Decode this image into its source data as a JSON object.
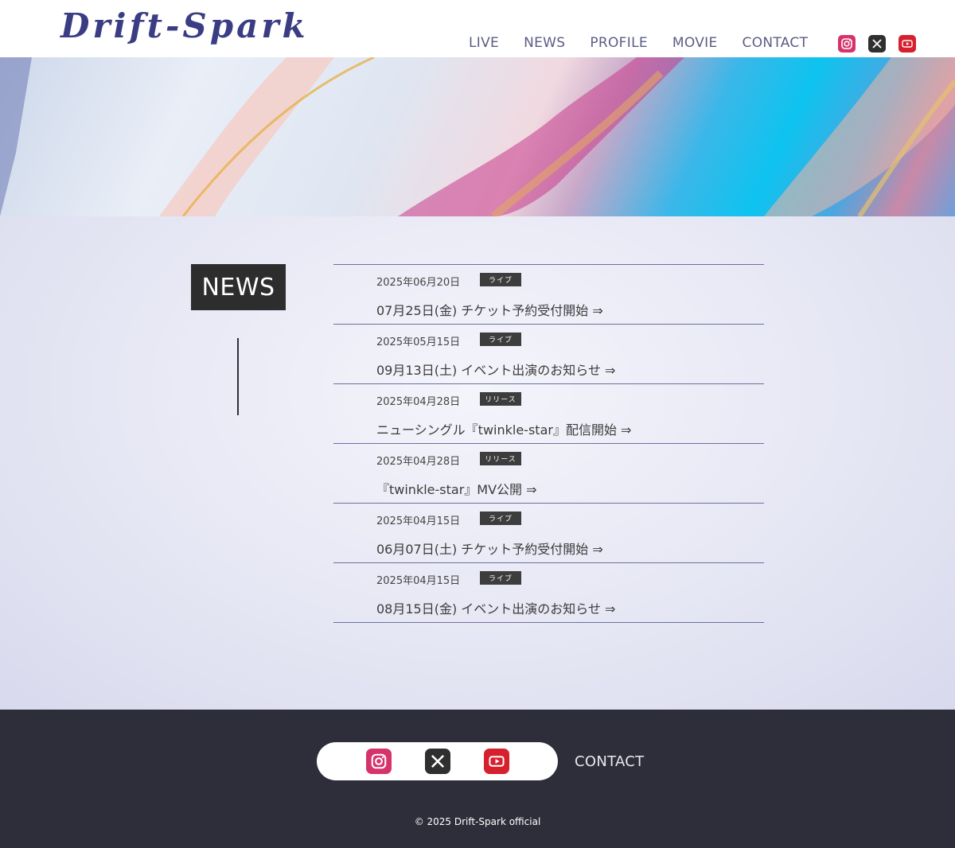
{
  "brand": {
    "logo_text": "Drift-Spark"
  },
  "nav": {
    "items": [
      {
        "label": "LIVE"
      },
      {
        "label": "NEWS"
      },
      {
        "label": "PROFILE"
      },
      {
        "label": "MOVIE"
      },
      {
        "label": "CONTACT"
      }
    ]
  },
  "social": {
    "icons": [
      "instagram-icon",
      "x-icon",
      "youtube-icon"
    ],
    "colors": {
      "instagram": "#d6336c",
      "x": "#2f2f2f",
      "youtube": "#d6202e"
    }
  },
  "news": {
    "heading": "NEWS",
    "items": [
      {
        "date": "2025年06月20日",
        "tag": "ライブ",
        "title": "07月25日(金) チケット予約受付開始 ⇒"
      },
      {
        "date": "2025年05月15日",
        "tag": "ライブ",
        "title": "09月13日(土) イベント出演のお知らせ ⇒"
      },
      {
        "date": "2025年04月28日",
        "tag": "リリース",
        "title": "ニューシングル『twinkle-star』配信開始 ⇒"
      },
      {
        "date": "2025年04月28日",
        "tag": "リリース",
        "title": "『twinkle-star』MV公開 ⇒"
      },
      {
        "date": "2025年04月15日",
        "tag": "ライブ",
        "title": "06月07日(土) チケット予約受付開始 ⇒"
      },
      {
        "date": "2025年04月15日",
        "tag": "ライブ",
        "title": "08月15日(金) イベント出演のお知らせ ⇒"
      }
    ]
  },
  "footer": {
    "contact_label": "CONTACT",
    "copyright": "© 2025 Drift-Spark official"
  },
  "colors": {
    "accent": "#3a3d84",
    "nav_text": "#5b5d84",
    "footer_bg": "#2e2e3b",
    "news_title_bg": "#2d2d2d",
    "divider": "#6b6f9e"
  }
}
